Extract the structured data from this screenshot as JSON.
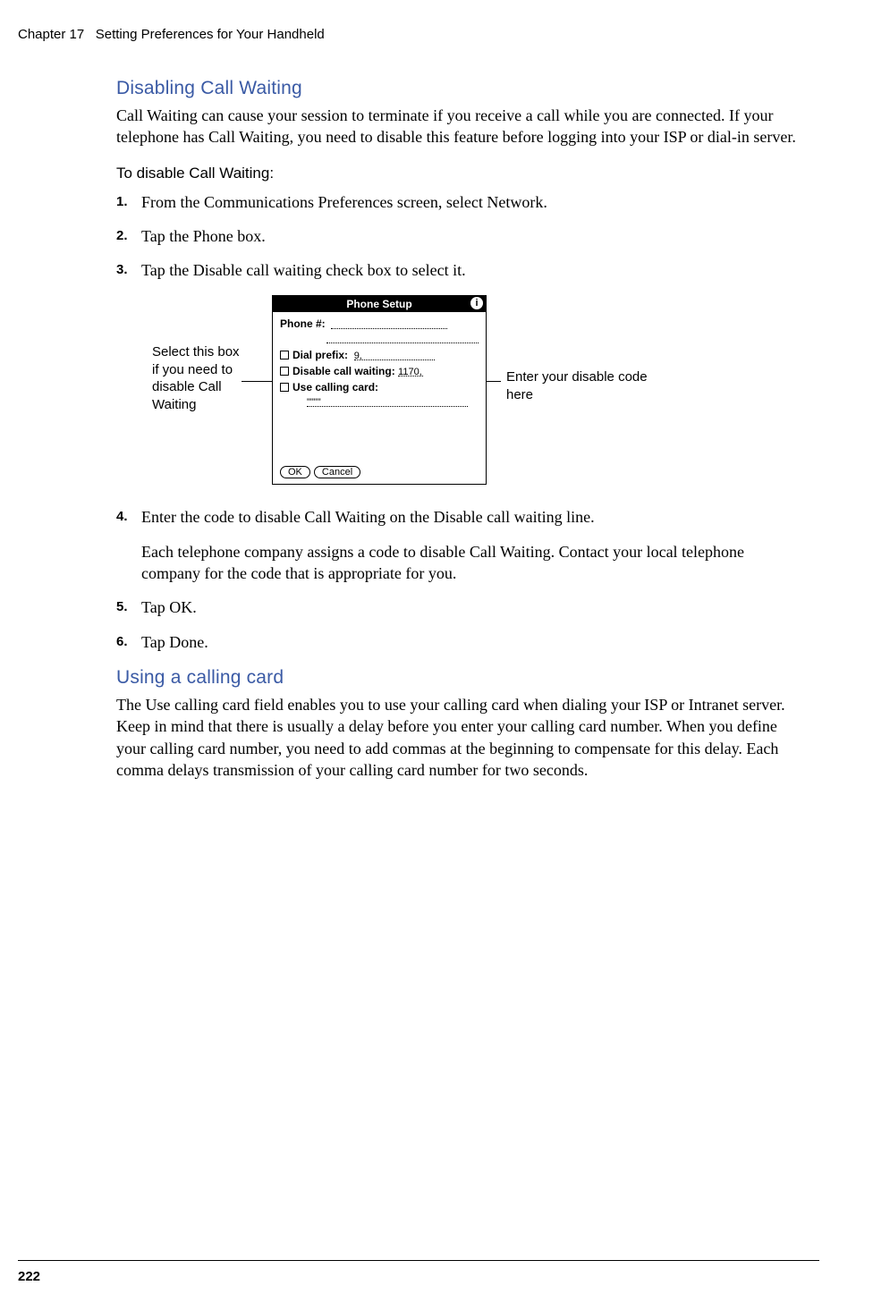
{
  "header": {
    "chapter": "Chapter 17",
    "title": "Setting Preferences for Your Handheld"
  },
  "section1": {
    "title": "Disabling Call Waiting",
    "intro": "Call Waiting can cause your session to terminate if you receive a call while you are connected. If your telephone has Call Waiting, you need to disable this feature before logging into your ISP or dial-in server.",
    "proc_heading": "To disable Call Waiting:",
    "steps": {
      "n1": "1.",
      "t1": "From the Communications Preferences screen, select Network.",
      "n2": "2.",
      "t2": "Tap the Phone box.",
      "n3": "3.",
      "t3": "Tap the Disable call waiting check box to select it.",
      "n4": "4.",
      "t4": "Enter the code to disable Call Waiting on the Disable call waiting line.",
      "sub4": "Each telephone company assigns a code to disable Call Waiting. Contact your local telephone company for the code that is appropriate for you.",
      "n5": "5.",
      "t5": "Tap OK.",
      "n6": "6.",
      "t6": "Tap Done."
    }
  },
  "figure": {
    "callout_left": "Select this box if you need to disable Call Waiting",
    "callout_right": "Enter your disable code here",
    "screen_title": "Phone Setup",
    "info_icon": "i",
    "phone_label": "Phone #:",
    "dial_prefix_label": "Dial prefix:",
    "dial_prefix_value": "9,",
    "disable_cw_label": "Disable call waiting:",
    "disable_cw_value": "1170,",
    "calling_card_label": "Use calling card:",
    "calling_card_value": "\"\"\"\"",
    "ok": "OK",
    "cancel": "Cancel"
  },
  "section2": {
    "title": "Using a calling card",
    "body": "The Use calling card field enables you to use your calling card when dialing your ISP or Intranet server. Keep in mind that there is usually a delay before you enter your calling card number. When you define your calling card number, you need to add commas at the beginning to compensate for this delay. Each comma delays transmission of your calling card number for two seconds."
  },
  "page_number": "222"
}
